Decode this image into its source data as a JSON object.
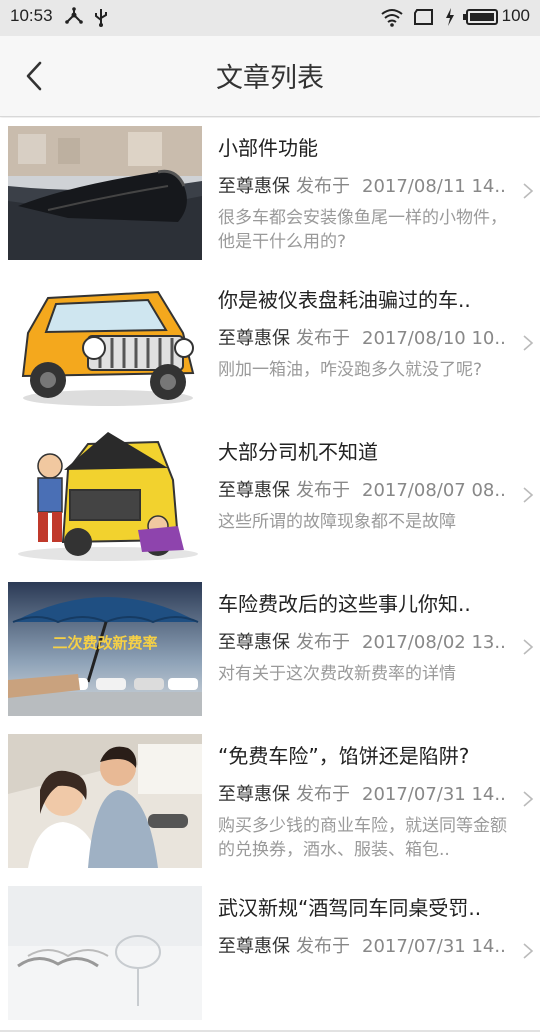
{
  "status_bar": {
    "time": "10:53",
    "battery": "100",
    "icons": [
      "usb-tether-icon",
      "usb-icon",
      "wifi-icon",
      "screen-icon",
      "charging-icon",
      "battery-icon"
    ]
  },
  "header": {
    "title": "文章列表",
    "back_icon": "chevron-left-icon"
  },
  "colors": {
    "header_bg": "#f7f7f7",
    "status_bg": "#e8e8e8",
    "divider": "#e2e2e2",
    "meta_gray": "#888888"
  },
  "articles": [
    {
      "title": "小部件功能",
      "author": "至尊惠保",
      "published_label": "发布于",
      "date": "2017/08/11 14..",
      "summary": "很多车都会安装像鱼尾一样的小物件，他是干什么用的?",
      "thumb": "shark-fin-antenna"
    },
    {
      "title": "你是被仪表盘耗油骗过的车..",
      "author": "至尊惠保",
      "published_label": "发布于",
      "date": "2017/08/10 10..",
      "summary": "刚加一箱油，咋没跑多久就没了呢?",
      "thumb": "cartoon-jeep"
    },
    {
      "title": "大部分司机不知道",
      "author": "至尊惠保",
      "published_label": "发布于",
      "date": "2017/08/07 08..",
      "summary": "这些所谓的故障现象都不是故障",
      "thumb": "broken-car-cartoon"
    },
    {
      "title": "车险费改后的这些事儿你知..",
      "author": "至尊惠保",
      "published_label": "发布于",
      "date": "2017/08/02 13..",
      "summary": "对有关于这次费改新费率的详情",
      "thumb": "umbrella-cars",
      "thumb_text": "二次费改新费率"
    },
    {
      "title": "“免费车险”，馅饼还是陷阱?",
      "author": "至尊惠保",
      "published_label": "发布于",
      "date": "2017/07/31 14..",
      "summary": "购买多少钱的商业车险，就送同等金额的兑换券，酒水、服装、箱包..",
      "thumb": "couple-in-car"
    },
    {
      "title": "武汉新规“酒驾同车同桌受罚..",
      "author": "至尊惠保",
      "published_label": "发布于",
      "date": "2017/07/31 14..",
      "summary": "",
      "thumb": "wine-glasses"
    }
  ]
}
